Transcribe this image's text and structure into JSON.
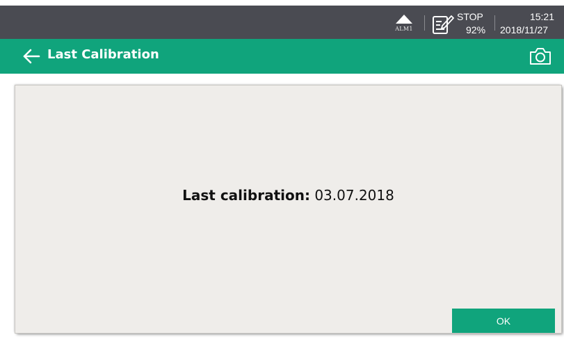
{
  "status_bar": {
    "alarm_label": "ALM1",
    "recording_status": "STOP",
    "memory_percent": "92%",
    "time": "15:21",
    "date": "2018/11/27"
  },
  "title_bar": {
    "title": "Last Calibration"
  },
  "dialog": {
    "label": "Last calibration:",
    "value": "03.07.2018",
    "ok_label": "OK"
  },
  "colors": {
    "status_bar_bg": "#4a4b52",
    "accent_green": "#10a47c",
    "panel_bg": "#efedea"
  },
  "icons": {
    "alarm": "alarm-triangle-icon",
    "recording": "note-pencil-icon",
    "back": "back-arrow-icon",
    "screenshot": "camera-icon"
  }
}
